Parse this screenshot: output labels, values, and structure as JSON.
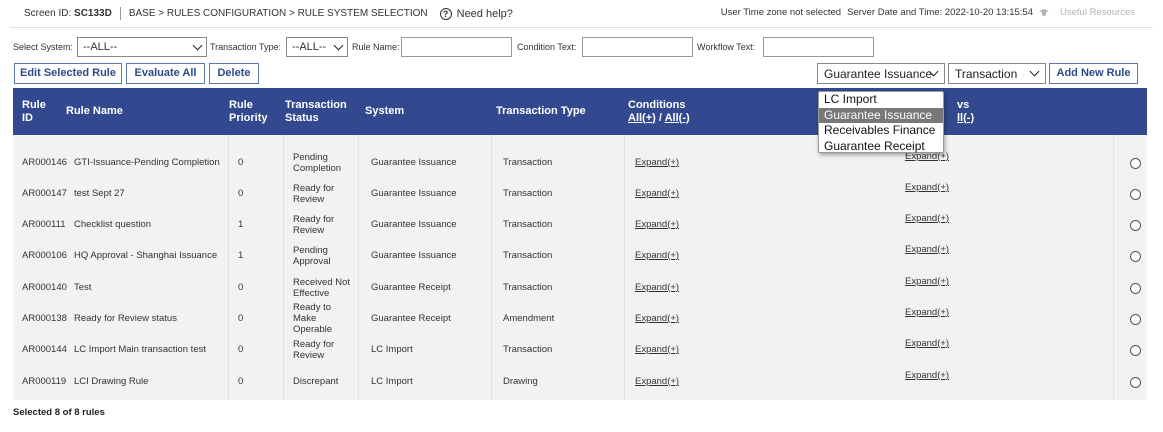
{
  "header": {
    "screen_id_label": "Screen ID:",
    "screen_id": "SC133D",
    "breadcrumb": "BASE > RULES CONFIGURATION > RULE SYSTEM SELECTION",
    "help": "Need help?",
    "timezone": "User Time zone not selected",
    "server_time": "Server Date and Time: 2022-10-20 13:15:54",
    "resources": "Useful Resources"
  },
  "filters": {
    "system_label": "Select System:",
    "system_value": "--ALL--",
    "txn_type_label": "Transaction Type:",
    "txn_type_value": "--ALL--",
    "rule_name_label": "Rule Name:",
    "condition_label": "Condition Text:",
    "workflow_label": "Workflow Text:"
  },
  "actions": {
    "edit": "Edit Selected Rule",
    "evaluate": "Evaluate All",
    "delete": "Delete",
    "system_select": "Guarantee Issuance",
    "type_select": "Transaction",
    "add": "Add New Rule"
  },
  "dropdown": {
    "options": [
      "LC Import",
      "Guarantee Issuance",
      "Receivables Finance",
      "Guarantee Receipt"
    ],
    "selected": "Guarantee Issuance"
  },
  "table": {
    "headers": {
      "rule_id": "Rule ID",
      "rule_name": "Rule Name",
      "priority": "Rule Priority",
      "status": "Transaction Status",
      "system": "System",
      "type": "Transaction Type",
      "conditions": "Conditions",
      "all_plus": "All(+)",
      "slash": "/",
      "all_minus": "All(-)",
      "workflows_tail": "vs",
      "workflows_all_minus_tail": "ll(-)"
    },
    "rows": [
      {
        "id": "AR000146",
        "name": "GTI-Issuance-Pending Completion",
        "priority": "0",
        "status": "Pending Completion",
        "system": "Guarantee Issuance",
        "type": "Transaction",
        "cond": "Expand(+)",
        "wf": "Expand(+)"
      },
      {
        "id": "AR000147",
        "name": "test Sept 27",
        "priority": "0",
        "status": "Ready for Review",
        "system": "Guarantee Issuance",
        "type": "Transaction",
        "cond": "Expand(+)",
        "wf": "Expand(+)"
      },
      {
        "id": "AR000111",
        "name": "Checklist question",
        "priority": "1",
        "status": "Ready for Review",
        "system": "Guarantee Issuance",
        "type": "Transaction",
        "cond": "Expand(+)",
        "wf": "Expand(+)"
      },
      {
        "id": "AR000106",
        "name": "HQ Approval - Shanghai Issuance",
        "priority": "1",
        "status": "Pending Approval",
        "system": "Guarantee Issuance",
        "type": "Transaction",
        "cond": "Expand(+)",
        "wf": "Expand(+)"
      },
      {
        "id": "AR000140",
        "name": "Test",
        "priority": "0",
        "status": "Received Not Effective",
        "system": "Guarantee Receipt",
        "type": "Transaction",
        "cond": "Expand(+)",
        "wf": "Expand(+)"
      },
      {
        "id": "AR000138",
        "name": "Ready for Review status",
        "priority": "0",
        "status": "Ready to Make Operable",
        "system": "Guarantee Receipt",
        "type": "Amendment",
        "cond": "Expand(+)",
        "wf": "Expand(+)"
      },
      {
        "id": "AR000144",
        "name": "LC Import Main transaction test",
        "priority": "0",
        "status": "Ready for Review",
        "system": "LC Import",
        "type": "Transaction",
        "cond": "Expand(+)",
        "wf": "Expand(+)"
      },
      {
        "id": "AR000119",
        "name": "LCI Drawing Rule",
        "priority": "0",
        "status": "Discrepant",
        "system": "LC Import",
        "type": "Drawing",
        "cond": "Expand(+)",
        "wf": "Expand(+)"
      }
    ]
  },
  "footer": {
    "selected": "Selected  8 of 8  rules"
  },
  "colors": {
    "header_bg": "#32498f",
    "button_border": "#5a78b5",
    "button_text": "#2c4a8a",
    "highlight": "#787878"
  }
}
